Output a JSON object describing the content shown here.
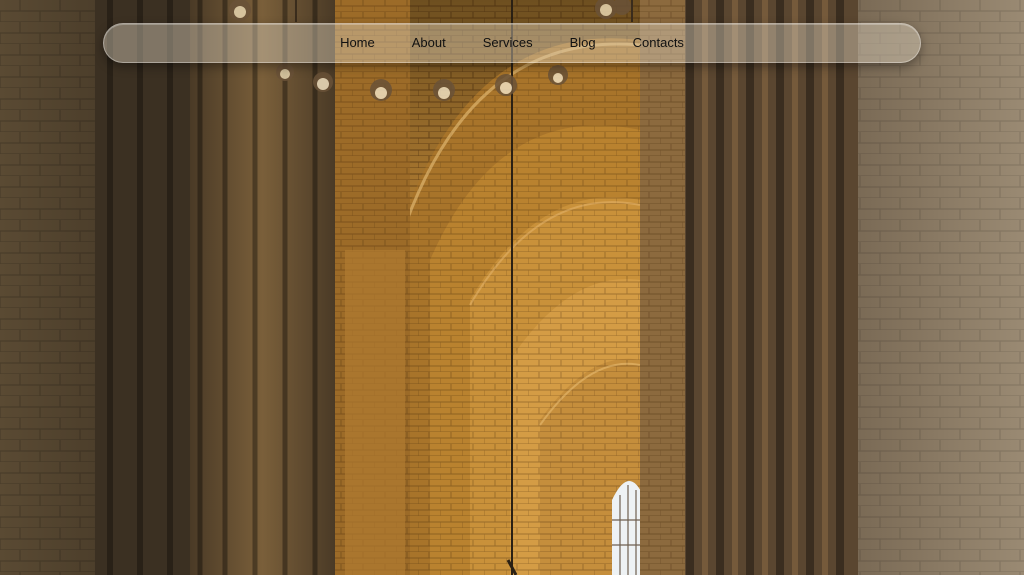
{
  "nav": {
    "items": [
      {
        "label": "Home"
      },
      {
        "label": "About"
      },
      {
        "label": "Services"
      },
      {
        "label": "Blog"
      },
      {
        "label": "Contacts"
      }
    ]
  },
  "colors": {
    "navbar_bg": "#d8ccb4",
    "nav_text": "#111111",
    "brick_warm": "#c8953e",
    "brick_dark": "#3a2e1c"
  }
}
